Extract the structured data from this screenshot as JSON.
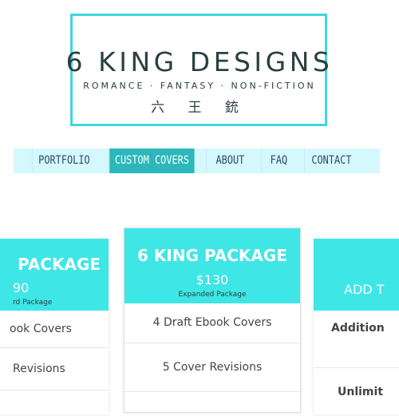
{
  "logo": {
    "title": "6 KING DESIGNS",
    "tagline": "ROMANCE · FANTASY · NON-FICTION",
    "kanji": "六 王 銃"
  },
  "nav": {
    "items": [
      "PORTFOLIO",
      "CUSTOM COVERS",
      "ABOUT",
      "FAQ",
      "CONTACT"
    ],
    "active": "CUSTOM COVERS"
  },
  "packages": {
    "left": {
      "name": "PACKAGE",
      "price": "90",
      "subtitle": "rd Package",
      "features": [
        "ook Covers",
        "Revisions"
      ]
    },
    "center": {
      "name": "6 KING PACKAGE",
      "price": "$130",
      "subtitle": "Expanded Package",
      "features": [
        "4 Draft Ebook Covers",
        "5 Cover Revisions"
      ]
    },
    "right": {
      "name": "ADD T",
      "features": [
        "Addition",
        "Unlimit"
      ]
    }
  },
  "colors": {
    "accent": "#3ee6e6",
    "nav_bg": "#d4f8fb",
    "nav_active": "#2bb7bb",
    "logo_border": "#3fd6e0"
  }
}
